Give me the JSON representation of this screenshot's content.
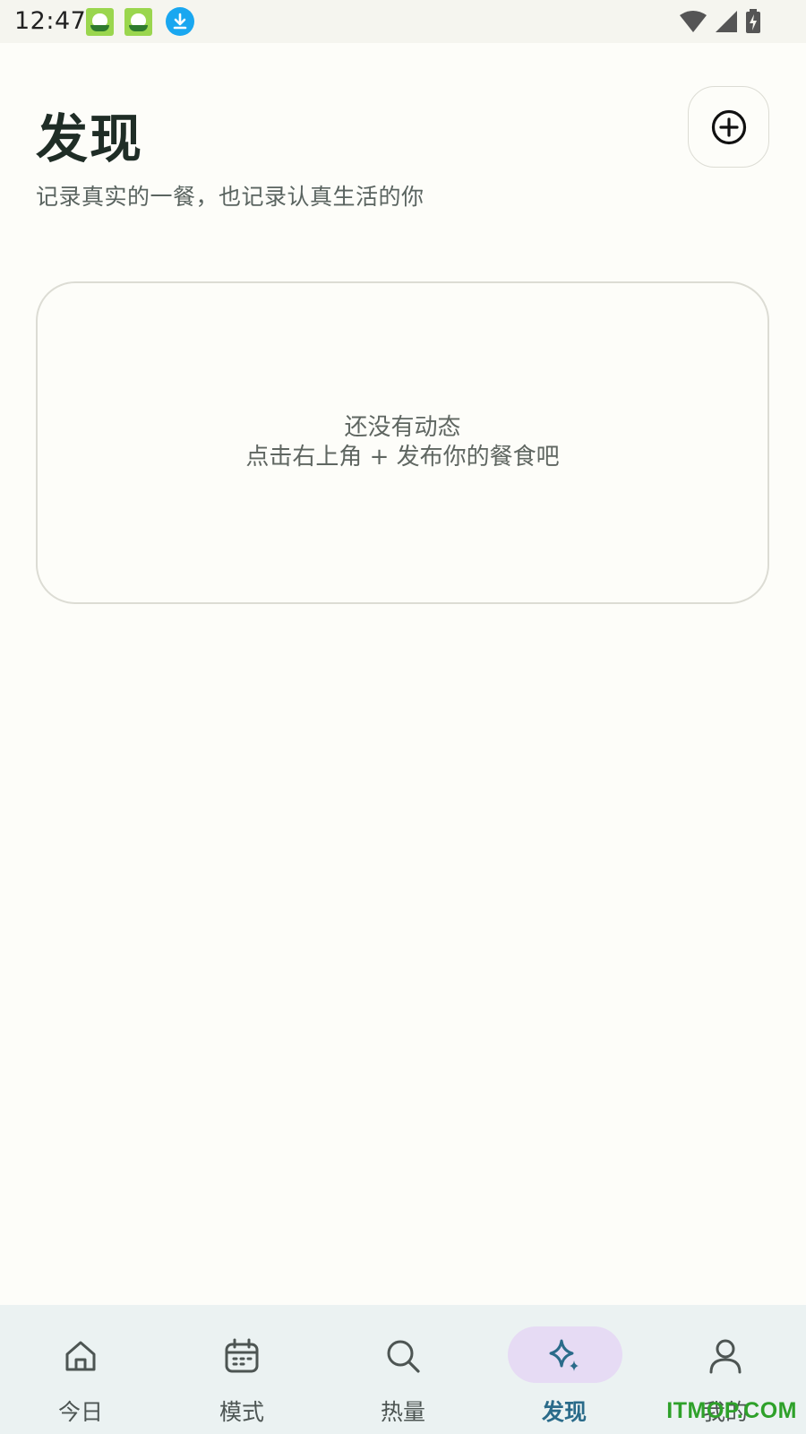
{
  "status_bar": {
    "time": "12:47",
    "icons": [
      "app-notification-icon",
      "app-notification-icon",
      "download-notification-icon",
      "wifi-icon",
      "signal-icon",
      "battery-charging-icon"
    ]
  },
  "header": {
    "title": "发现",
    "subtitle": "记录真实的一餐，也记录认真生活的你",
    "add_icon": "plus-circle-icon"
  },
  "empty_state": {
    "line1": "还没有动态",
    "line2": "点击右上角 + 发布你的餐食吧"
  },
  "bottom_nav": {
    "items": [
      {
        "label": "今日",
        "icon": "home-icon",
        "active": false
      },
      {
        "label": "模式",
        "icon": "calendar-icon",
        "active": false
      },
      {
        "label": "热量",
        "icon": "search-icon",
        "active": false
      },
      {
        "label": "发现",
        "icon": "sparkle-icon",
        "active": true
      },
      {
        "label": "我的",
        "icon": "person-icon",
        "active": false
      }
    ]
  },
  "watermark": "ITMOP.COM",
  "colors": {
    "background": "#fdfdf9",
    "title": "#1f2d26",
    "nav_background": "#ebf2f2",
    "active_pill": "#e6dbf4",
    "active_label": "#2a6b8a",
    "download_badge": "#19a7f0",
    "watermark": "#2ea12a"
  }
}
